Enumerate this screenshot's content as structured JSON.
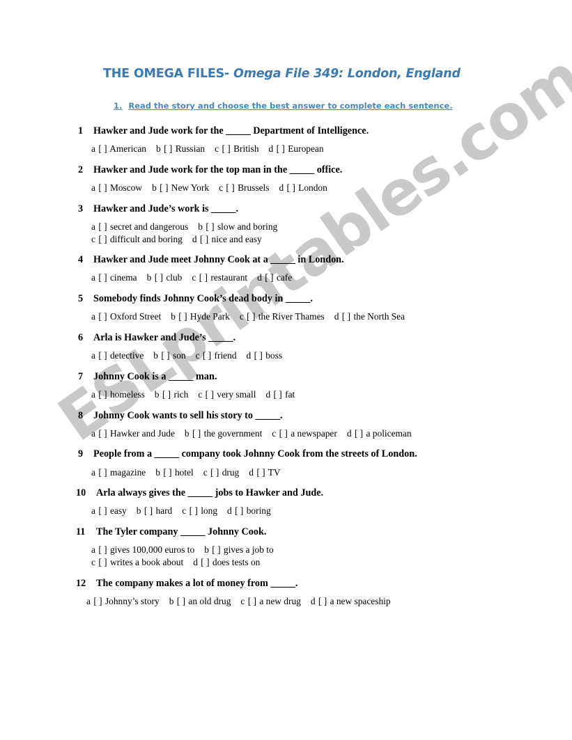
{
  "watermark": {
    "text": "ESLprintables.com",
    "color": "#c9c9c9"
  },
  "header": {
    "title_bold": "THE OMEGA FILES- ",
    "title_italic": "Omega File 349: London, England",
    "accent_color": "#3b79b5"
  },
  "instruction": {
    "number": "1.",
    "text": "Read the story and choose the best answer to complete each sentence.",
    "color": "#4a86c0"
  },
  "questions": [
    {
      "number": "1",
      "prompt_pre": "Hawker and Jude work for the ",
      "blank": "_____",
      "prompt_post": " Department of Intelligence.",
      "rows": [
        [
          {
            "letter": "a",
            "box": "[  ]",
            "label": "American"
          },
          {
            "letter": "b",
            "box": "[  ]",
            "label": "Russian"
          },
          {
            "letter": "c",
            "box": "[  ]",
            "label": "British"
          },
          {
            "letter": "d",
            "box": "[  ]",
            "label": "European"
          }
        ]
      ]
    },
    {
      "number": "2",
      "prompt_pre": "Hawker and Jude work for the top man in the ",
      "blank": "_____",
      "prompt_post": " office.",
      "rows": [
        [
          {
            "letter": "a",
            "box": "[  ]",
            "label": "Moscow"
          },
          {
            "letter": "b",
            "box": "[  ]",
            "label": "New York"
          },
          {
            "letter": "c",
            "box": "[  ]",
            "label": "Brussels"
          },
          {
            "letter": "d",
            "box": "[  ]",
            "label": "London"
          }
        ]
      ]
    },
    {
      "number": "3",
      "prompt_pre": "Hawker and Jude’s work is ",
      "blank": "_____",
      "prompt_post": ".",
      "rows": [
        [
          {
            "letter": "a",
            "box": "[  ]",
            "label": "secret and dangerous"
          },
          {
            "letter": "b",
            "box": "[  ]",
            "label": "slow and boring"
          }
        ],
        [
          {
            "letter": "c",
            "box": "[  ]",
            "label": "difficult and boring"
          },
          {
            "letter": "d",
            "box": "[  ]",
            "label": "nice and easy"
          }
        ]
      ]
    },
    {
      "number": "4",
      "prompt_pre": "Hawker and Jude meet Johnny Cook at a ",
      "blank": "_____",
      "prompt_post": " in London.",
      "rows": [
        [
          {
            "letter": "a",
            "box": "[  ]",
            "label": "cinema"
          },
          {
            "letter": "b",
            "box": "[  ]",
            "label": "club"
          },
          {
            "letter": "c",
            "box": "[  ]",
            "label": "restaurant"
          },
          {
            "letter": "d",
            "box": "[  ]",
            "label": "cafe"
          }
        ]
      ]
    },
    {
      "number": "5",
      "prompt_pre": "Somebody finds Johnny Cook’s dead body in ",
      "blank": "_____",
      "prompt_post": ".",
      "rows": [
        [
          {
            "letter": "a",
            "box": "[  ]",
            "label": "Oxford Street"
          },
          {
            "letter": "b",
            "box": "[  ]",
            "label": "Hyde Park"
          },
          {
            "letter": "c",
            "box": "[  ]",
            "label": "the River Thames"
          },
          {
            "letter": "d",
            "box": "[  ]",
            "label": "the North Sea"
          }
        ]
      ]
    },
    {
      "number": "6",
      "prompt_pre": "Arla is Hawker and Jude’s ",
      "blank": "_____",
      "prompt_post": ".",
      "rows": [
        [
          {
            "letter": "a",
            "box": "[  ]",
            "label": "detective"
          },
          {
            "letter": "b",
            "box": "[  ]",
            "label": "son"
          },
          {
            "letter": "c",
            "box": "[  ]",
            "label": "friend"
          },
          {
            "letter": "d",
            "box": "[  ]",
            "label": "boss"
          }
        ]
      ]
    },
    {
      "number": "7",
      "prompt_pre": "Johnny Cook is a ",
      "blank": "_____",
      "prompt_post": " man.",
      "rows": [
        [
          {
            "letter": "a",
            "box": "[  ]",
            "label": "homeless"
          },
          {
            "letter": "b",
            "box": "[  ]",
            "label": "rich"
          },
          {
            "letter": "c",
            "box": "[  ]",
            "label": "very small"
          },
          {
            "letter": "d",
            "box": "[  ]",
            "label": "fat"
          }
        ]
      ]
    },
    {
      "number": "8",
      "prompt_pre": "Johnny Cook wants to sell his story to ",
      "blank": "_____",
      "prompt_post": ".",
      "rows": [
        [
          {
            "letter": "a",
            "box": "[  ]",
            "label": "Hawker and Jude"
          },
          {
            "letter": "b",
            "box": "[  ]",
            "label": "the government"
          },
          {
            "letter": "c",
            "box": "[  ]",
            "label": "a newspaper"
          },
          {
            "letter": "d",
            "box": "[  ]",
            "label": "a policeman"
          }
        ]
      ]
    },
    {
      "number": "9",
      "prompt_pre": "People from a ",
      "blank": "_____",
      "prompt_post": " company took Johnny Cook from the streets of London.",
      "rows": [
        [
          {
            "letter": "a",
            "box": "[  ]",
            "label": "magazine"
          },
          {
            "letter": "b",
            "box": "[  ]",
            "label": "hotel"
          },
          {
            "letter": "c",
            "box": "[  ]",
            "label": "drug"
          },
          {
            "letter": "d",
            "box": "[  ]",
            "label": "TV"
          }
        ]
      ]
    },
    {
      "number": "10",
      "prompt_pre": "Arla always gives the ",
      "blank": "_____",
      "prompt_post": " jobs to Hawker and Jude.",
      "rows": [
        [
          {
            "letter": "a",
            "box": "[  ]",
            "label": "easy"
          },
          {
            "letter": "b",
            "box": "[  ]",
            "label": "hard"
          },
          {
            "letter": "c",
            "box": "[  ]",
            "label": "long"
          },
          {
            "letter": "d",
            "box": "[  ]",
            "label": "boring"
          }
        ]
      ]
    },
    {
      "number": "11",
      "prompt_pre": "The Tyler company ",
      "blank": "_____",
      "prompt_post": " Johnny Cook.",
      "rows": [
        [
          {
            "letter": "a",
            "box": "[  ]",
            "label": "gives 100,000 euros to"
          },
          {
            "letter": "b",
            "box": "[  ]",
            "label": "gives a job to"
          }
        ],
        [
          {
            "letter": "c",
            "box": "[  ]",
            "label": "writes a book about"
          },
          {
            "letter": "d",
            "box": "[  ]",
            "label": "does tests on"
          }
        ]
      ]
    },
    {
      "number": "12",
      "prompt_pre": "The company makes a lot of money from ",
      "blank": "_____",
      "prompt_post": ".",
      "rows": [
        [
          {
            "letter": "a",
            "box": "[  ]",
            "label": "Johnny’s story"
          },
          {
            "letter": "b",
            "box": "[  ]",
            "label": "an old drug"
          },
          {
            "letter": "c",
            "box": "[  ]",
            "label": "a new drug"
          },
          {
            "letter": "d",
            "box": "[  ]",
            "label": "a new spaceship"
          }
        ]
      ]
    }
  ]
}
